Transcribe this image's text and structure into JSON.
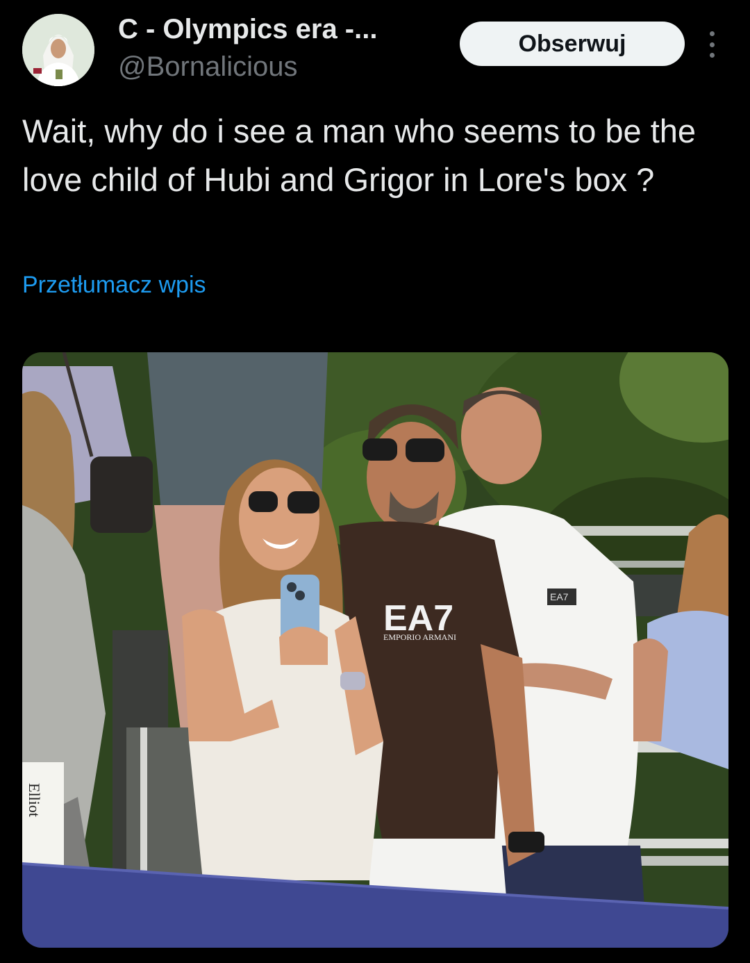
{
  "author": {
    "display_name": "C - Olympics era -...",
    "handle": "@Bornalicious"
  },
  "follow_button": {
    "label": "Obserwuj"
  },
  "tweet": {
    "text": "Wait, why do i see a man who seems to be the love child of Hubi and Grigor in Lore's box ?",
    "translate_label": "Przetłumacz wpis"
  },
  "media": {
    "shirt_logo": "EA7",
    "shirt_brand": "EMPORIO ARMANI",
    "chest_logo": "EA7",
    "sign_text": "Elliot"
  },
  "colors": {
    "background": "#000000",
    "text_primary": "#e7e9ea",
    "text_secondary": "#71767b",
    "link": "#1d9bf0",
    "button_bg": "#eff3f4",
    "button_text": "#0f1419"
  }
}
